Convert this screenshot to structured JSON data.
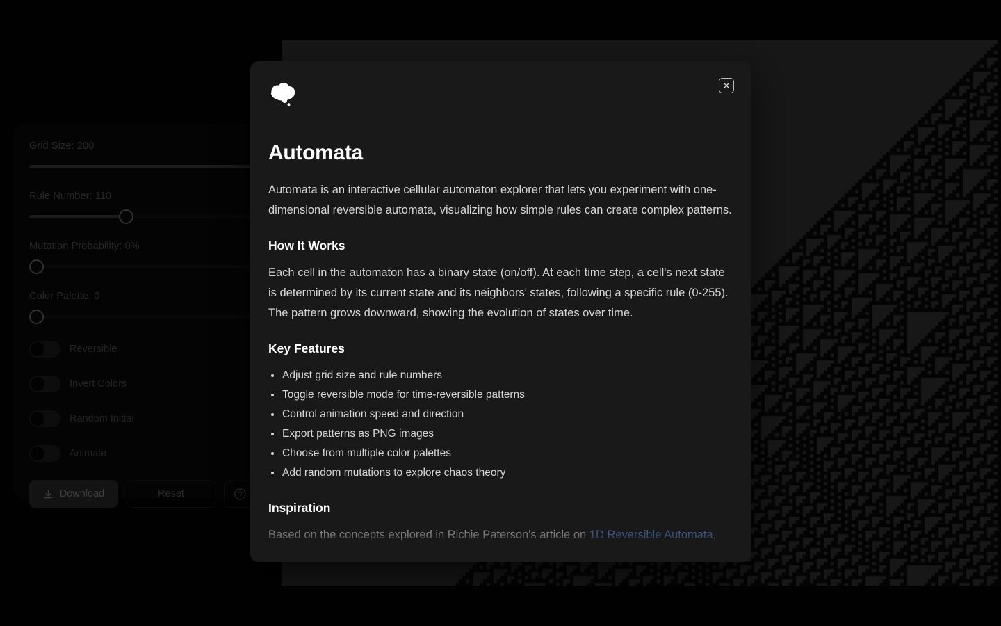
{
  "theme": {
    "page_bg": "#030303",
    "panel_bg": "#0b0b0b",
    "canvas_bg": "#333333",
    "cell_color": "#0a0a0a",
    "modal_bg": "#191919",
    "link_color": "#5b8cde",
    "text_muted": "#585858",
    "text_body": "#d5d5d5"
  },
  "controls": {
    "sliders": [
      {
        "name": "grid-size",
        "label": "Grid Size: 200",
        "value": 200,
        "min": 10,
        "max": 200,
        "percent": 100
      },
      {
        "name": "rule-number",
        "label": "Rule Number: 110",
        "value": 110,
        "min": 0,
        "max": 255,
        "percent": 43
      },
      {
        "name": "mutation-probability",
        "label": "Mutation Probability: 0%",
        "value": 0,
        "min": 0,
        "max": 100,
        "percent": 0
      },
      {
        "name": "color-palette",
        "label": "Color Palette: 0",
        "value": 0,
        "min": 0,
        "max": 5,
        "percent": 0
      }
    ],
    "toggles": [
      {
        "name": "reversible",
        "label": "Reversible",
        "checked": false
      },
      {
        "name": "invert-colors",
        "label": "Invert Colors",
        "checked": false
      },
      {
        "name": "random-initial",
        "label": "Random Initial",
        "checked": false
      },
      {
        "name": "animate",
        "label": "Animate",
        "checked": false
      }
    ],
    "buttons": {
      "download": "Download",
      "reset": "Reset",
      "help_icon": "question-circle-icon",
      "download_icon": "download-icon"
    }
  },
  "modal": {
    "logo_icon": "thought-bubble-icon",
    "close_icon": "close-icon",
    "title": "Automata",
    "intro": "Automata is an interactive cellular automaton explorer that lets you experiment with one-dimensional reversible automata, visualizing how simple rules can create complex patterns.",
    "how_it_works": {
      "heading": "How It Works",
      "body": "Each cell in the automaton has a binary state (on/off). At each time step, a cell's next state is determined by its current state and its neighbors' states, following a specific rule (0-255). The pattern grows downward, showing the evolution of states over time."
    },
    "key_features": {
      "heading": "Key Features",
      "items": [
        "Adjust grid size and rule numbers",
        "Toggle reversible mode for time-reversible patterns",
        "Control animation speed and direction",
        "Export patterns as PNG images",
        "Choose from multiple color palettes",
        "Add random mutations to explore chaos theory"
      ]
    },
    "inspiration": {
      "heading": "Inspiration",
      "body_before": "Based on the concepts explored in Richie Paterson's article on ",
      "link_text": "1D Reversible Automata",
      "body_after": ", this"
    }
  },
  "automaton": {
    "rule": 110,
    "grid_size": 200,
    "cell_color": "#0a0a0a",
    "background": "#333333"
  }
}
